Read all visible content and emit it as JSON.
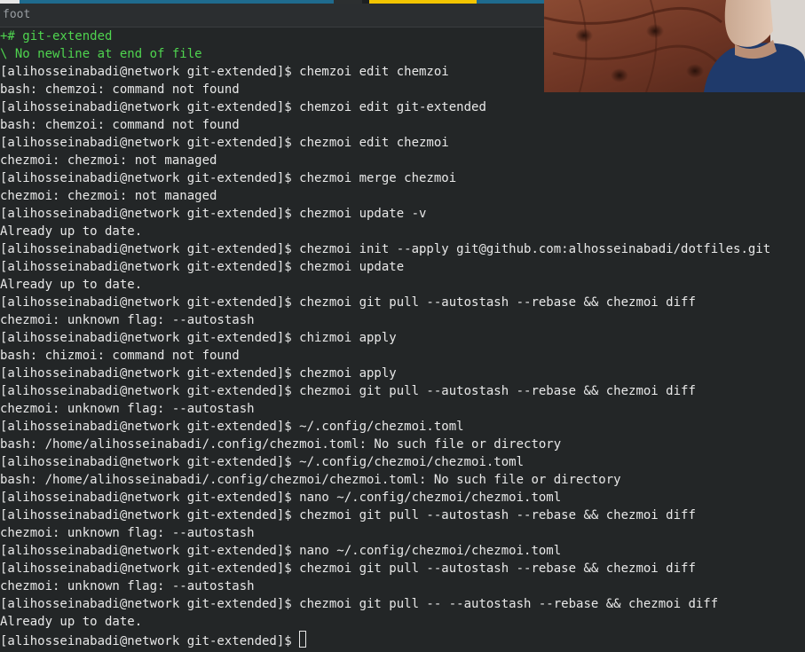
{
  "window": {
    "title": "foot"
  },
  "terminal": {
    "lines": [
      {
        "text": "+# git-extended",
        "kind": "diff-green"
      },
      {
        "text": "\\ No newline at end of file",
        "kind": "diff-note"
      },
      {
        "text": "[alihosseinabadi@network git-extended]$ chemzoi edit chemzoi",
        "kind": "prompt"
      },
      {
        "text": "bash: chemzoi: command not found",
        "kind": "output"
      },
      {
        "text": "[alihosseinabadi@network git-extended]$ chemzoi edit git-extended",
        "kind": "prompt"
      },
      {
        "text": "bash: chemzoi: command not found",
        "kind": "output"
      },
      {
        "text": "[alihosseinabadi@network git-extended]$ chezmoi edit chezmoi",
        "kind": "prompt"
      },
      {
        "text": "chezmoi: chezmoi: not managed",
        "kind": "output"
      },
      {
        "text": "[alihosseinabadi@network git-extended]$ chezmoi merge chezmoi",
        "kind": "prompt"
      },
      {
        "text": "chezmoi: chezmoi: not managed",
        "kind": "output"
      },
      {
        "text": "[alihosseinabadi@network git-extended]$ chezmoi update -v",
        "kind": "prompt"
      },
      {
        "text": "Already up to date.",
        "kind": "output"
      },
      {
        "text": "[alihosseinabadi@network git-extended]$ chezmoi init --apply git@github.com:alhosseinabadi/dotfiles.git",
        "kind": "prompt"
      },
      {
        "text": "[alihosseinabadi@network git-extended]$ chezmoi update",
        "kind": "prompt"
      },
      {
        "text": "Already up to date.",
        "kind": "output"
      },
      {
        "text": "[alihosseinabadi@network git-extended]$ chezmoi git pull --autostash --rebase && chezmoi diff",
        "kind": "prompt"
      },
      {
        "text": "chezmoi: unknown flag: --autostash",
        "kind": "output"
      },
      {
        "text": "[alihosseinabadi@network git-extended]$ chizmoi apply",
        "kind": "prompt"
      },
      {
        "text": "bash: chizmoi: command not found",
        "kind": "output"
      },
      {
        "text": "[alihosseinabadi@network git-extended]$ chezmoi apply",
        "kind": "prompt"
      },
      {
        "text": "[alihosseinabadi@network git-extended]$ chezmoi git pull --autostash --rebase && chezmoi diff",
        "kind": "prompt"
      },
      {
        "text": "chezmoi: unknown flag: --autostash",
        "kind": "output"
      },
      {
        "text": "[alihosseinabadi@network git-extended]$ ~/.config/chezmoi.toml",
        "kind": "prompt"
      },
      {
        "text": "bash: /home/alihosseinabadi/.config/chezmoi.toml: No such file or directory",
        "kind": "output"
      },
      {
        "text": "[alihosseinabadi@network git-extended]$ ~/.config/chezmoi/chezmoi.toml",
        "kind": "prompt"
      },
      {
        "text": "bash: /home/alihosseinabadi/.config/chezmoi/chezmoi.toml: No such file or directory",
        "kind": "output"
      },
      {
        "text": "[alihosseinabadi@network git-extended]$ nano ~/.config/chezmoi/chezmoi.toml",
        "kind": "prompt"
      },
      {
        "text": "[alihosseinabadi@network git-extended]$ chezmoi git pull --autostash --rebase && chezmoi diff",
        "kind": "prompt"
      },
      {
        "text": "chezmoi: unknown flag: --autostash",
        "kind": "output"
      },
      {
        "text": "[alihosseinabadi@network git-extended]$ nano ~/.config/chezmoi/chezmoi.toml",
        "kind": "prompt"
      },
      {
        "text": "[alihosseinabadi@network git-extended]$ chezmoi git pull --autostash --rebase && chezmoi diff",
        "kind": "prompt"
      },
      {
        "text": "chezmoi: unknown flag: --autostash",
        "kind": "output"
      },
      {
        "text": "[alihosseinabadi@network git-extended]$ chezmoi git pull -- --autostash --rebase && chezmoi diff",
        "kind": "prompt"
      },
      {
        "text": "Already up to date.",
        "kind": "output"
      }
    ],
    "current_prompt": "[alihosseinabadi@network git-extended]$ "
  },
  "colors": {
    "background": "#232627",
    "foreground": "#e8e8e8",
    "diff_green": "#4fd44f",
    "accent_blue": "#1f6b8e",
    "accent_yellow": "#f2c500"
  }
}
